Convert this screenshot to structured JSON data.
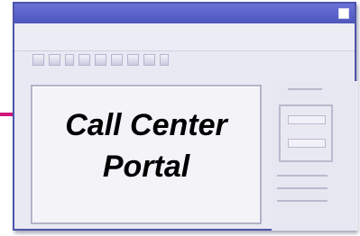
{
  "window": {
    "title_text": "",
    "panel_title": "Call Center Portal"
  },
  "colors": {
    "title_bar": "#4d56bb",
    "window_border": "#4c55a9",
    "connector": "#d0157a"
  },
  "icons": {
    "toolbar": [
      "toolbar-icon-1",
      "toolbar-icon-2",
      "toolbar-icon-3",
      "toolbar-icon-4",
      "toolbar-icon-5",
      "toolbar-icon-6",
      "toolbar-icon-7",
      "toolbar-icon-8",
      "toolbar-icon-9"
    ]
  }
}
